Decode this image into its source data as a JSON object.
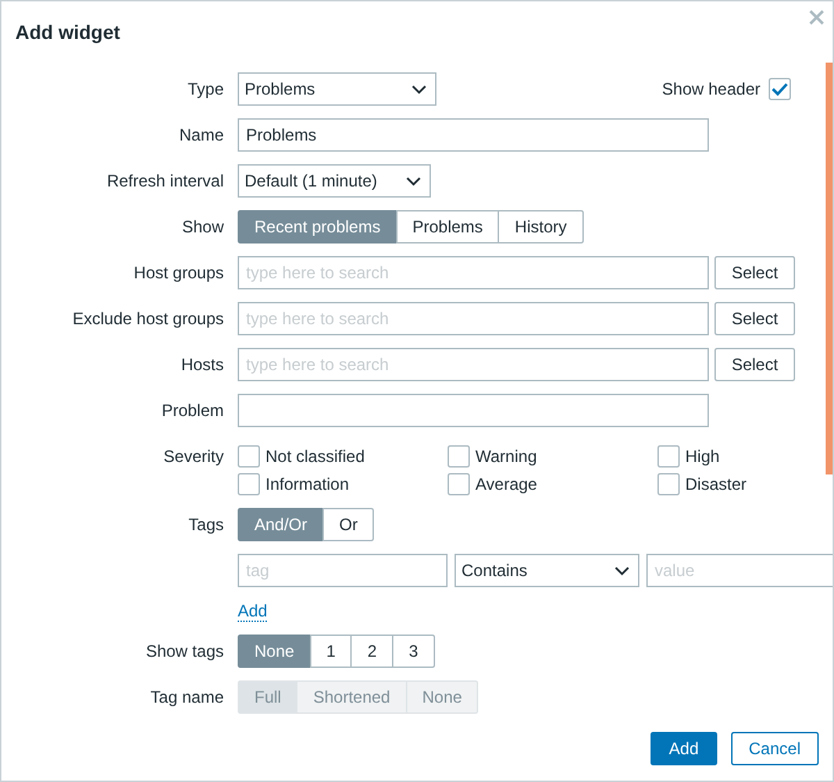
{
  "dialog": {
    "title": "Add widget"
  },
  "fields": [
    {
      "kind": "select",
      "label": "Type",
      "value": "Problems",
      "side_checkbox": {
        "label": "Show header",
        "checked": true
      }
    },
    {
      "kind": "text",
      "label": "Name",
      "value": "Problems"
    },
    {
      "kind": "select",
      "label": "Refresh interval",
      "value": "Default (1 minute)"
    },
    {
      "kind": "segmented",
      "label": "Show",
      "disabled": false,
      "options": [
        {
          "label": "Recent problems",
          "selected": true
        },
        {
          "label": "Problems",
          "selected": false
        },
        {
          "label": "History",
          "selected": false
        }
      ]
    },
    {
      "kind": "multiselect",
      "label": "Host groups",
      "placeholder": "type here to search",
      "button": "Select"
    },
    {
      "kind": "multiselect",
      "label": "Exclude host groups",
      "placeholder": "type here to search",
      "button": "Select"
    },
    {
      "kind": "multiselect",
      "label": "Hosts",
      "placeholder": "type here to search",
      "button": "Select"
    },
    {
      "kind": "text",
      "label": "Problem"
    },
    {
      "kind": "checkboxes",
      "label": "Severity",
      "options": [
        {
          "label": "Not classified",
          "checked": false
        },
        {
          "label": "Information",
          "checked": false
        },
        {
          "label": "Warning",
          "checked": false
        },
        {
          "label": "Average",
          "checked": false
        },
        {
          "label": "High",
          "checked": false
        },
        {
          "label": "Disaster",
          "checked": false
        }
      ]
    },
    {
      "kind": "segmented",
      "label": "Tags",
      "disabled": false,
      "options": [
        {
          "label": "And/Or",
          "selected": true
        },
        {
          "label": "Or",
          "selected": false
        }
      ]
    },
    {
      "kind": "tag_filters",
      "rows": [
        {
          "tag_placeholder": "tag",
          "operator": "Contains",
          "value_placeholder": "value"
        }
      ],
      "add_link": "Add"
    },
    {
      "kind": "segmented",
      "label": "Show tags",
      "disabled": false,
      "options": [
        {
          "label": "None",
          "selected": true
        },
        {
          "label": "1",
          "selected": false
        },
        {
          "label": "2",
          "selected": false
        },
        {
          "label": "3",
          "selected": false
        }
      ]
    },
    {
      "kind": "segmented",
      "label": "Tag name",
      "disabled": true,
      "options": [
        {
          "label": "Full",
          "selected": true
        },
        {
          "label": "Shortened",
          "selected": false
        },
        {
          "label": "None",
          "selected": false
        }
      ]
    }
  ],
  "buttons": [
    {
      "label": "Add",
      "kind": "primary"
    },
    {
      "label": "Cancel",
      "kind": "secondary"
    }
  ]
}
